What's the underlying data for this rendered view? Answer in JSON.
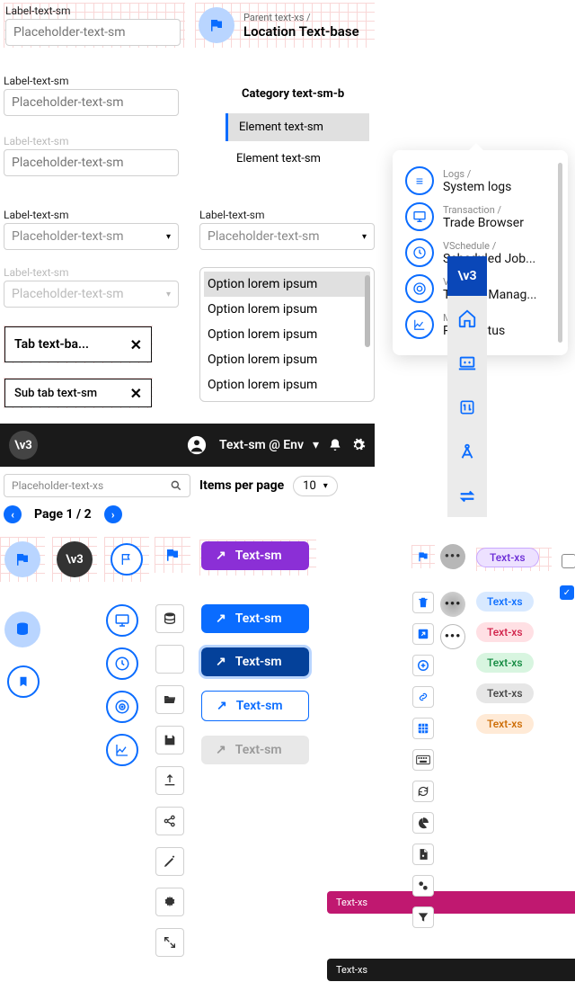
{
  "inputs": {
    "i1": {
      "label": "Label-text-sm",
      "ph": "Placeholder-text-sm"
    },
    "i2": {
      "label": "Label-text-sm",
      "ph": "Placeholder-text-sm"
    },
    "i3": {
      "label": "Label-text-sm",
      "ph": "Placeholder-text-sm"
    },
    "s1": {
      "label": "Label-text-sm",
      "ph": "Placeholder-text-sm"
    },
    "s2": {
      "label": "Label-text-sm",
      "ph": "Placeholder-text-sm"
    },
    "s3": {
      "label": "Label-text-sm",
      "ph": "Placeholder-text-sm"
    }
  },
  "dropdown": {
    "options": [
      "Option lorem ipsum",
      "Option lorem ipsum",
      "Option lorem ipsum",
      "Option lorem ipsum",
      "Option lorem ipsum"
    ]
  },
  "tabs": {
    "main": "Tab text-ba...",
    "sub": "Sub tab text-sm"
  },
  "header": {
    "text": "Text-sm @ Env"
  },
  "search": {
    "ph": "Placeholder-text-xs"
  },
  "items_per_page": {
    "label": "Items per page",
    "value": "10"
  },
  "paging": {
    "text": "Page 1 / 2"
  },
  "location": {
    "crumb": "Parent text-xs /",
    "title": "Location Text-base"
  },
  "elements": {
    "cat": "Category text-sm-b",
    "e1": "Element text-sm",
    "e2": "Element text-sm"
  },
  "popover": {
    "items": [
      {
        "k": "Logs /",
        "v": "System logs"
      },
      {
        "k": "Transaction /",
        "v": "Trade Browser"
      },
      {
        "k": "VSchedule /",
        "v": "Scheduled Job..."
      },
      {
        "k": "VELT /",
        "v": "Targets Manag..."
      },
      {
        "k": "Main /",
        "v": "PnA Status"
      }
    ]
  },
  "logo": {
    "text": "\\v3"
  },
  "buttons": {
    "t": "Text-sm"
  },
  "badges": {
    "t": "Text-xs"
  },
  "tooltips": {
    "t": "Text-xs"
  }
}
